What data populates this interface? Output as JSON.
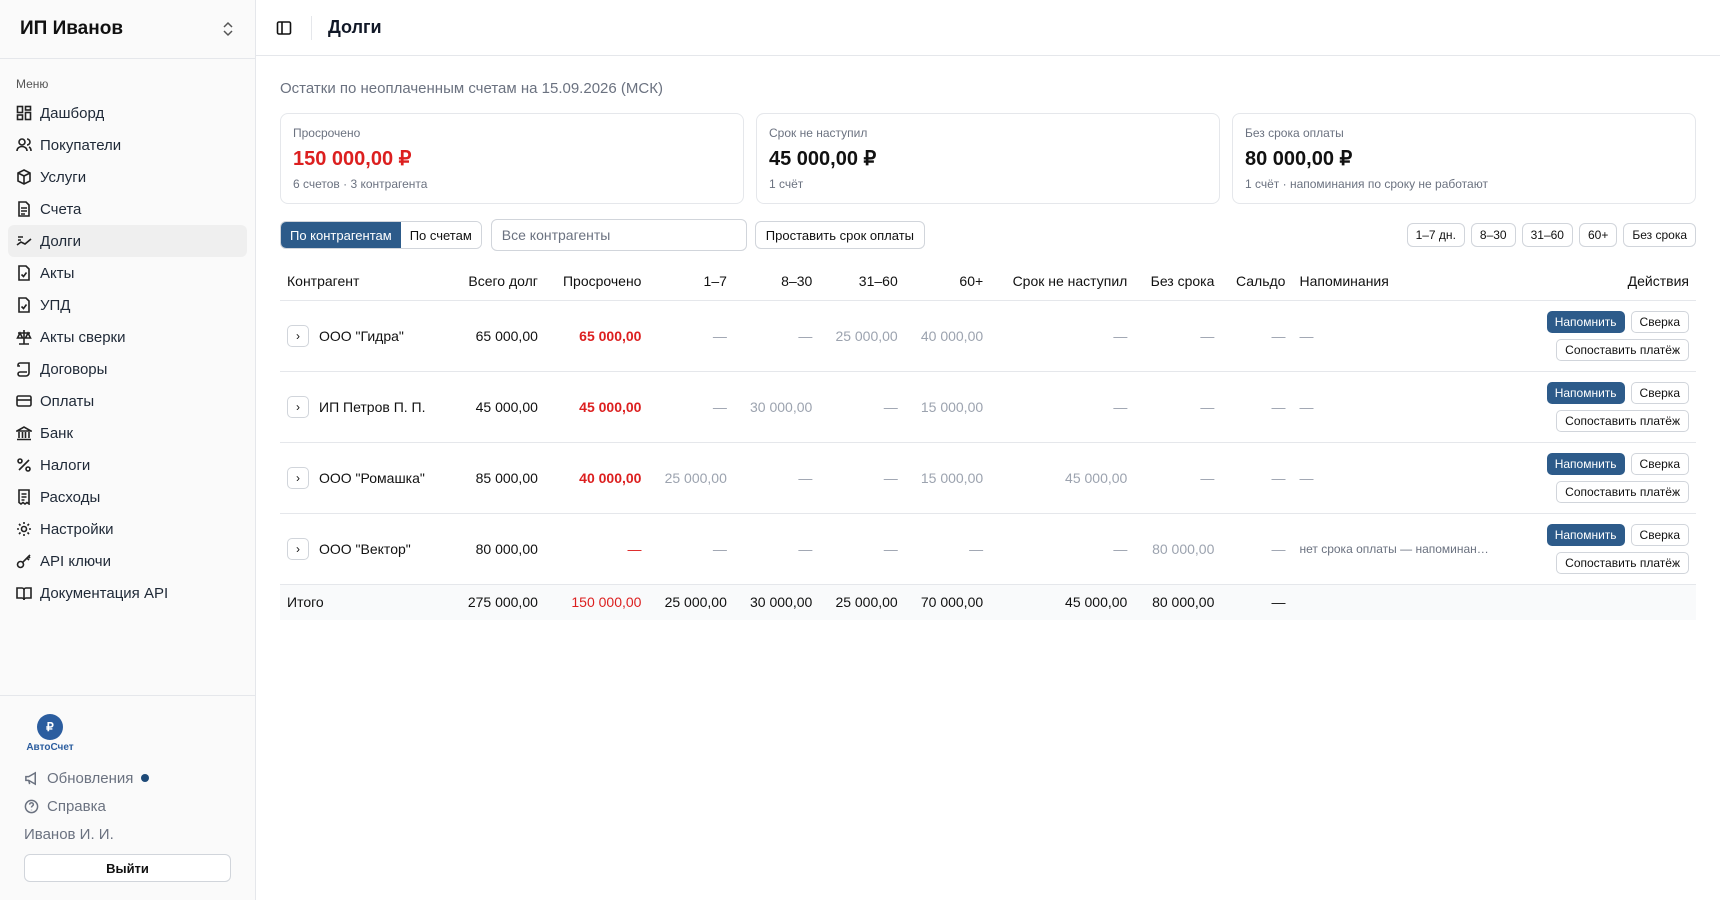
{
  "sidebar": {
    "org_name": "ИП Иванов",
    "menu_label": "Меню",
    "items": [
      {
        "label": "Дашборд",
        "icon": "dashboard-icon"
      },
      {
        "label": "Покупатели",
        "icon": "users-icon"
      },
      {
        "label": "Услуги",
        "icon": "box-icon"
      },
      {
        "label": "Счета",
        "icon": "file-icon"
      },
      {
        "label": "Долги",
        "icon": "debts-icon",
        "active": true
      },
      {
        "label": "Акты",
        "icon": "file-check-icon"
      },
      {
        "label": "УПД",
        "icon": "file-check-icon"
      },
      {
        "label": "Акты сверки",
        "icon": "scale-icon"
      },
      {
        "label": "Договоры",
        "icon": "scroll-icon"
      },
      {
        "label": "Оплаты",
        "icon": "card-icon"
      },
      {
        "label": "Банк",
        "icon": "bank-icon"
      },
      {
        "label": "Налоги",
        "icon": "percent-icon"
      },
      {
        "label": "Расходы",
        "icon": "receipt-icon"
      },
      {
        "label": "Настройки",
        "icon": "gear-icon"
      },
      {
        "label": "API ключи",
        "icon": "key-icon"
      },
      {
        "label": "Документация API",
        "icon": "book-icon"
      }
    ],
    "logo_text": "АвтоСчет",
    "updates_label": "Обновления",
    "help_label": "Справка",
    "user_name": "Иванов И. И.",
    "logout_label": "Выйти"
  },
  "header": {
    "title": "Долги"
  },
  "main": {
    "subtitle": "Остатки по неоплаченным счетам на 15.09.2026 (МСК)",
    "cards": [
      {
        "label": "Просрочено",
        "value": "150 000,00 ₽",
        "note": "6 счетов · 3 контрагента",
        "red": true
      },
      {
        "label": "Срок не наступил",
        "value": "45 000,00 ₽",
        "note": "1 счёт",
        "red": false
      },
      {
        "label": "Без срока оплаты",
        "value": "80 000,00 ₽",
        "note": "1 счёт · напоминания по сроку не работают",
        "red": false
      }
    ],
    "view_tabs": [
      "По контрагентам",
      "По счетам"
    ],
    "filter_placeholder": "Все контрагенты",
    "set_due_label": "Проставить срок оплаты",
    "chips": [
      "1–7 дн.",
      "8–30",
      "31–60",
      "60+",
      "Без срока"
    ],
    "columns": [
      "Контрагент",
      "Всего долг",
      "Просрочено",
      "1–7",
      "8–30",
      "31–60",
      "60+",
      "Срок не наступил",
      "Без срока",
      "Сальдо",
      "Напоминания",
      "Действия"
    ],
    "rows": [
      {
        "name": "ООО \"Гидра\"",
        "total": "65 000,00",
        "overdue": "65 000,00",
        "d1_7": "—",
        "d8_30": "—",
        "d31_60": "25 000,00",
        "d60": "40 000,00",
        "not_due": "—",
        "no_term": "—",
        "balance": "—",
        "reminders": "—"
      },
      {
        "name": "ИП Петров П. П.",
        "total": "45 000,00",
        "overdue": "45 000,00",
        "d1_7": "—",
        "d8_30": "30 000,00",
        "d31_60": "—",
        "d60": "15 000,00",
        "not_due": "—",
        "no_term": "—",
        "balance": "—",
        "reminders": "—"
      },
      {
        "name": "ООО \"Ромашка\"",
        "total": "85 000,00",
        "overdue": "40 000,00",
        "d1_7": "25 000,00",
        "d8_30": "—",
        "d31_60": "—",
        "d60": "15 000,00",
        "not_due": "45 000,00",
        "no_term": "—",
        "balance": "—",
        "reminders": "—"
      },
      {
        "name": "ООО \"Вектор\"",
        "total": "80 000,00",
        "overdue": "—",
        "d1_7": "—",
        "d8_30": "—",
        "d31_60": "—",
        "d60": "—",
        "not_due": "—",
        "no_term": "80 000,00",
        "balance": "—",
        "reminders": "нет срока оплаты — напоминания не отправляются"
      }
    ],
    "actions": {
      "remind": "Напомнить",
      "reconcile": "Сверка",
      "match": "Сопоставить платёж"
    },
    "total_row": {
      "label": "Итого",
      "total": "275 000,00",
      "overdue": "150 000,00",
      "d1_7": "25 000,00",
      "d8_30": "30 000,00",
      "d31_60": "25 000,00",
      "d60": "70 000,00",
      "not_due": "45 000,00",
      "no_term": "80 000,00",
      "balance": "—"
    }
  },
  "colors": {
    "accent": "#2d5b8a",
    "danger": "#dc1f1f",
    "muted": "#9ca3af"
  }
}
